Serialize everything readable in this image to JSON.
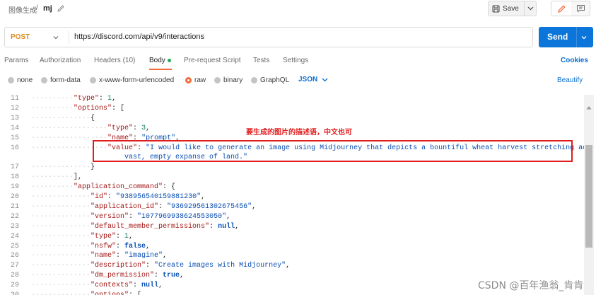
{
  "header": {
    "breadcrumb_parent": "图像生成",
    "breadcrumb_separator": "/",
    "request_name": "mj",
    "save_label": "Save"
  },
  "request": {
    "method": "POST",
    "url": "https://discord.com/api/v9/interactions",
    "send_label": "Send"
  },
  "tabs": [
    {
      "label": "Params"
    },
    {
      "label": "Authorization"
    },
    {
      "label": "Headers (10)"
    },
    {
      "label": "Body",
      "active": true
    },
    {
      "label": "Pre-request Script"
    },
    {
      "label": "Tests"
    },
    {
      "label": "Settings"
    }
  ],
  "cookies_label": "Cookies",
  "body_types": [
    {
      "label": "none"
    },
    {
      "label": "form-data"
    },
    {
      "label": "x-www-form-urlencoded"
    },
    {
      "label": "raw",
      "selected": true
    },
    {
      "label": "binary"
    },
    {
      "label": "GraphQL"
    }
  ],
  "format": "JSON",
  "beautify_label": "Beautify",
  "editor": {
    "lines": [
      {
        "num": "11",
        "segments": [
          {
            "t": "··········",
            "c": "guide"
          },
          {
            "t": "\"type\"",
            "c": "k"
          },
          {
            "t": ": ",
            "c": ""
          },
          {
            "t": "1",
            "c": "n"
          },
          {
            "t": ",",
            "c": ""
          }
        ]
      },
      {
        "num": "12",
        "segments": [
          {
            "t": "··········",
            "c": "guide"
          },
          {
            "t": "\"options\"",
            "c": "k"
          },
          {
            "t": ": [",
            "c": ""
          }
        ]
      },
      {
        "num": "13",
        "segments": [
          {
            "t": "··············",
            "c": "guide"
          },
          {
            "t": "{",
            "c": ""
          }
        ]
      },
      {
        "num": "14",
        "segments": [
          {
            "t": "··················",
            "c": "guide"
          },
          {
            "t": "\"type\"",
            "c": "k"
          },
          {
            "t": ": ",
            "c": ""
          },
          {
            "t": "3",
            "c": "n"
          },
          {
            "t": ",",
            "c": ""
          }
        ]
      },
      {
        "num": "15",
        "segments": [
          {
            "t": "··················",
            "c": "guide"
          },
          {
            "t": "\"name\"",
            "c": "k"
          },
          {
            "t": ": ",
            "c": ""
          },
          {
            "t": "\"prompt\"",
            "c": "s"
          },
          {
            "t": ",",
            "c": ""
          }
        ]
      },
      {
        "num": "16",
        "segments": [
          {
            "t": "··················",
            "c": "guide"
          },
          {
            "t": "\"value\"",
            "c": "k"
          },
          {
            "t": ": ",
            "c": ""
          },
          {
            "t": "\"I would like to generate an image using Midjourney that depicts a bountiful wheat harvest stretching across the",
            "c": "s"
          }
        ]
      },
      {
        "num": "",
        "segments": [
          {
            "t": "                      ",
            "c": ""
          },
          {
            "t": "vast, empty expanse of land.\"",
            "c": "s"
          }
        ]
      },
      {
        "num": "17",
        "segments": [
          {
            "t": "··············",
            "c": "guide"
          },
          {
            "t": "}",
            "c": ""
          }
        ]
      },
      {
        "num": "18",
        "segments": [
          {
            "t": "··········",
            "c": "guide"
          },
          {
            "t": "],",
            "c": ""
          }
        ]
      },
      {
        "num": "19",
        "segments": [
          {
            "t": "··········",
            "c": "guide"
          },
          {
            "t": "\"application_command\"",
            "c": "k"
          },
          {
            "t": ": {",
            "c": ""
          }
        ]
      },
      {
        "num": "20",
        "segments": [
          {
            "t": "··············",
            "c": "guide"
          },
          {
            "t": "\"id\"",
            "c": "k"
          },
          {
            "t": ": ",
            "c": ""
          },
          {
            "t": "\"938956540159881230\"",
            "c": "s"
          },
          {
            "t": ",",
            "c": ""
          }
        ]
      },
      {
        "num": "21",
        "segments": [
          {
            "t": "··············",
            "c": "guide"
          },
          {
            "t": "\"application_id\"",
            "c": "k"
          },
          {
            "t": ": ",
            "c": ""
          },
          {
            "t": "\"936929561302675456\"",
            "c": "s"
          },
          {
            "t": ",",
            "c": ""
          }
        ]
      },
      {
        "num": "22",
        "segments": [
          {
            "t": "··············",
            "c": "guide"
          },
          {
            "t": "\"version\"",
            "c": "k"
          },
          {
            "t": ": ",
            "c": ""
          },
          {
            "t": "\"1077969938624553050\"",
            "c": "s"
          },
          {
            "t": ",",
            "c": ""
          }
        ]
      },
      {
        "num": "23",
        "segments": [
          {
            "t": "··············",
            "c": "guide"
          },
          {
            "t": "\"default_member_permissions\"",
            "c": "k"
          },
          {
            "t": ": ",
            "c": ""
          },
          {
            "t": "null",
            "c": "b"
          },
          {
            "t": ",",
            "c": ""
          }
        ]
      },
      {
        "num": "24",
        "segments": [
          {
            "t": "··············",
            "c": "guide"
          },
          {
            "t": "\"type\"",
            "c": "k"
          },
          {
            "t": ": ",
            "c": ""
          },
          {
            "t": "1",
            "c": "n"
          },
          {
            "t": ",",
            "c": ""
          }
        ]
      },
      {
        "num": "25",
        "segments": [
          {
            "t": "··············",
            "c": "guide"
          },
          {
            "t": "\"nsfw\"",
            "c": "k"
          },
          {
            "t": ": ",
            "c": ""
          },
          {
            "t": "false",
            "c": "b"
          },
          {
            "t": ",",
            "c": ""
          }
        ]
      },
      {
        "num": "26",
        "segments": [
          {
            "t": "··············",
            "c": "guide"
          },
          {
            "t": "\"name\"",
            "c": "k"
          },
          {
            "t": ": ",
            "c": ""
          },
          {
            "t": "\"imagine\"",
            "c": "s"
          },
          {
            "t": ",",
            "c": ""
          }
        ]
      },
      {
        "num": "27",
        "segments": [
          {
            "t": "··············",
            "c": "guide"
          },
          {
            "t": "\"description\"",
            "c": "k"
          },
          {
            "t": ": ",
            "c": ""
          },
          {
            "t": "\"Create images with Midjourney\"",
            "c": "s"
          },
          {
            "t": ",",
            "c": ""
          }
        ]
      },
      {
        "num": "28",
        "segments": [
          {
            "t": "··············",
            "c": "guide"
          },
          {
            "t": "\"dm_permission\"",
            "c": "k"
          },
          {
            "t": ": ",
            "c": ""
          },
          {
            "t": "true",
            "c": "b"
          },
          {
            "t": ",",
            "c": ""
          }
        ]
      },
      {
        "num": "29",
        "segments": [
          {
            "t": "··············",
            "c": "guide"
          },
          {
            "t": "\"contexts\"",
            "c": "k"
          },
          {
            "t": ": ",
            "c": ""
          },
          {
            "t": "null",
            "c": "b"
          },
          {
            "t": ",",
            "c": ""
          }
        ]
      },
      {
        "num": "30",
        "segments": [
          {
            "t": "··············",
            "c": "guide"
          },
          {
            "t": "\"options\"",
            "c": "k"
          },
          {
            "t": ": [",
            "c": ""
          }
        ]
      }
    ]
  },
  "annotation": {
    "text": "要生成的图片的描述语，中文也可",
    "color": "#e11c1c"
  },
  "watermark": "CSDN @百年渔翁_肯肯",
  "colors": {
    "accent_orange": "#f26b3a",
    "send_blue": "#0b75d9",
    "link_blue": "#0b6fcf",
    "method_orange": "#d88a1e"
  }
}
